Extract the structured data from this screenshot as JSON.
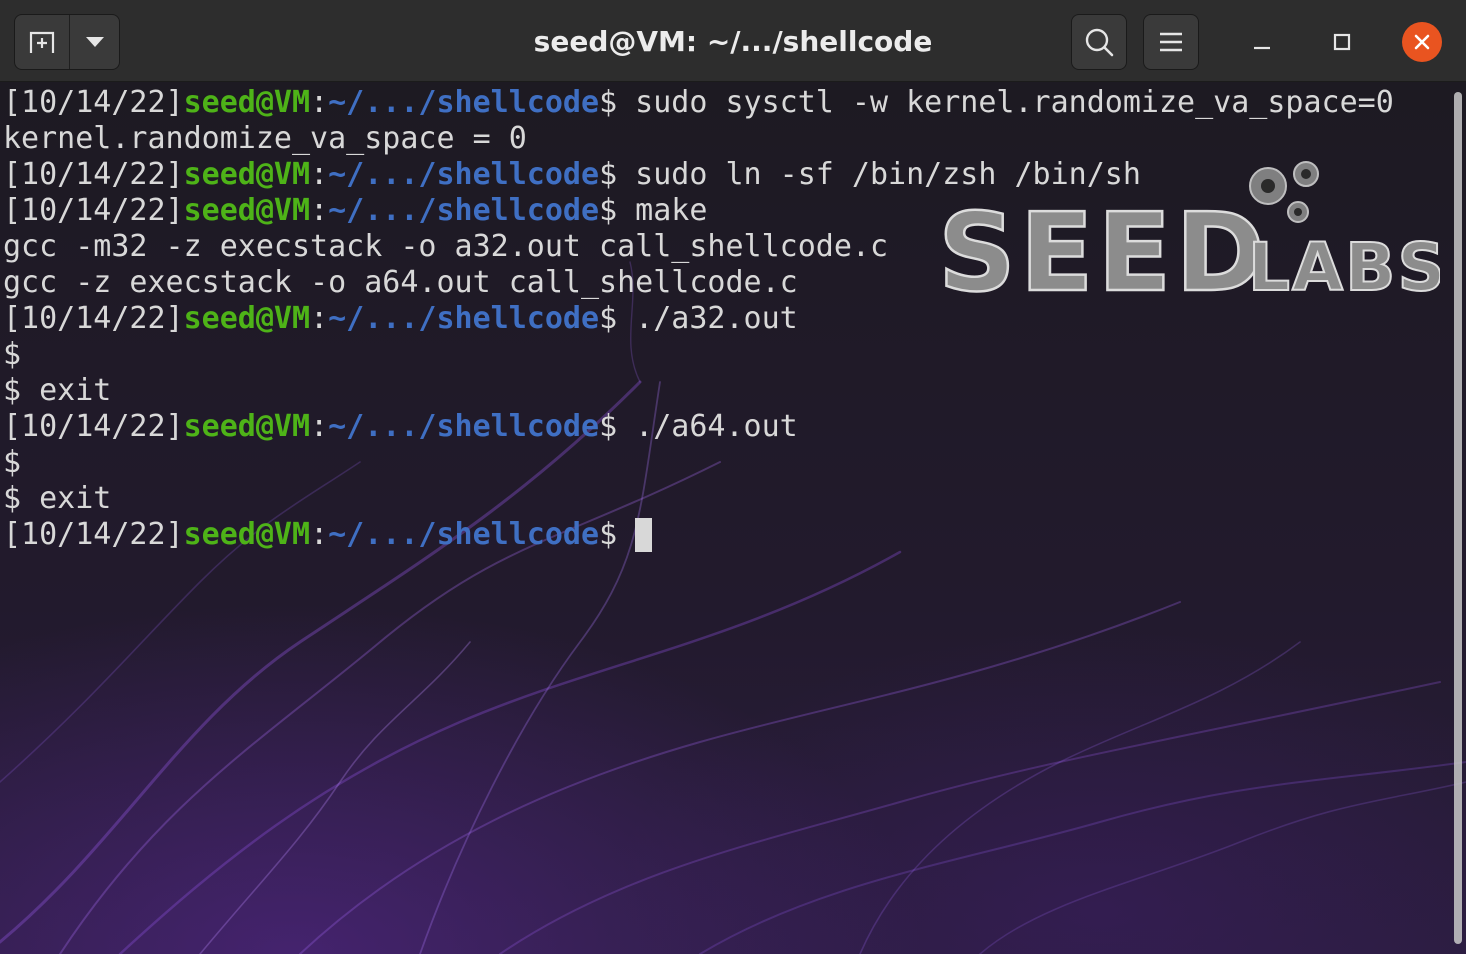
{
  "window": {
    "title": "seed@VM: ~/.../shellcode",
    "icons": {
      "new_tab": "new-tab-icon",
      "tab_menu": "chevron-down-icon",
      "search": "search-icon",
      "menu": "hamburger-menu-icon",
      "minimize": "minimize-icon",
      "maximize": "maximize-icon",
      "close": "close-icon"
    },
    "close_color": "#e95420"
  },
  "prompt": {
    "date": "[10/14/22]",
    "user": "seed@VM",
    "colon": ":",
    "path": "~/.../shellcode",
    "dollar": "$"
  },
  "colors": {
    "user": "#4eb318",
    "path": "#3f6fc3",
    "text": "#d8d8d8"
  },
  "terminal": {
    "lines": [
      {
        "type": "prompt",
        "cmd": " sudo sysctl -w kernel.randomize_va_space=0"
      },
      {
        "type": "output",
        "text": "kernel.randomize_va_space = 0"
      },
      {
        "type": "prompt",
        "cmd": " sudo ln -sf /bin/zsh /bin/sh"
      },
      {
        "type": "prompt",
        "cmd": " make"
      },
      {
        "type": "output",
        "text": "gcc -m32 -z execstack -o a32.out call_shellcode.c"
      },
      {
        "type": "output",
        "text": "gcc -z execstack -o a64.out call_shellcode.c"
      },
      {
        "type": "prompt",
        "cmd": " ./a32.out"
      },
      {
        "type": "output",
        "text": "$"
      },
      {
        "type": "output",
        "text": "$ exit"
      },
      {
        "type": "prompt",
        "cmd": " ./a64.out"
      },
      {
        "type": "output",
        "text": "$"
      },
      {
        "type": "output",
        "text": "$ exit"
      },
      {
        "type": "prompt",
        "cmd": " ",
        "cursor": true
      }
    ]
  },
  "watermark": {
    "seed": "SEED",
    "labs": "LABS"
  }
}
